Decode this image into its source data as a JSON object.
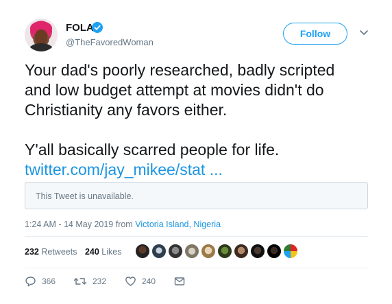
{
  "author": {
    "name": "FOLA",
    "handle": "@TheFavoredWoman",
    "verified": true
  },
  "header": {
    "follow_label": "Follow"
  },
  "tweet": {
    "line1": "Your dad's poorly researched, badly scripted",
    "line2": "and low budget attempt at movies didn't do",
    "line3": "Christianity any favors either.",
    "line4": "Y'all basically scarred people for life.",
    "link": "twitter.com/jay_mikee/stat ..."
  },
  "embed": {
    "unavailable_text": "This Tweet is unavailable."
  },
  "meta": {
    "timestamp": "1:24 AM - 14 May 2019 from ",
    "location": "Victoria Island, Nigeria"
  },
  "stats": {
    "retweets_count": "232",
    "retweets_label": "Retweets",
    "likes_count": "240",
    "likes_label": "Likes"
  },
  "likers": [
    {
      "icon": "avatar"
    },
    {
      "icon": "avatar"
    },
    {
      "icon": "avatar"
    },
    {
      "icon": "avatar"
    },
    {
      "icon": "avatar"
    },
    {
      "icon": "avatar"
    },
    {
      "icon": "avatar"
    },
    {
      "icon": "avatar"
    },
    {
      "icon": "avatar"
    },
    {
      "icon": "avatar"
    }
  ],
  "actions": {
    "reply_count": "366",
    "retweet_count": "232",
    "like_count": "240"
  },
  "colors": {
    "accent": "#1da1f2",
    "link": "#1b95e0",
    "muted": "#657786",
    "text": "#14171a"
  }
}
